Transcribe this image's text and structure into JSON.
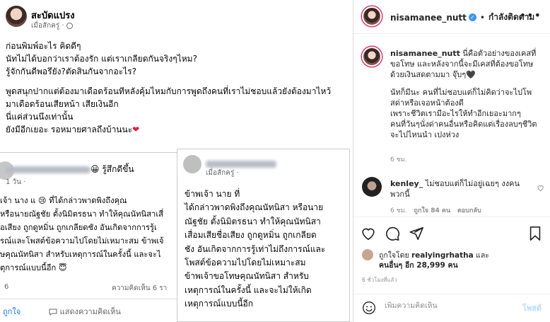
{
  "post_image": {
    "author": "สะบัดแปรง",
    "time": "เมื่อสักครู่ ·",
    "text_lines": [
      "ก่อนพิมพ์อะไร คิดดีๆ",
      "นัทไม่ได้บอกว่าเราต้องรัก แต่เราเกลียดกันจริงๆไหม?",
      "รู้จักกันดีพอรึยัง?ตัดสินกันจากอะไร?",
      "",
      "พูดสนุกปากแต่ต้องมาเดือดร้อนทีหลังคุ้มไหมกับการพูดถึงคนที่เราไม่ชอบแล้วยังต้องมาไหว้",
      "มาเดือดร้อนเสียหน้า เสียเงินอีก",
      "นี่แค่ส่วนนึงเท่านั้น",
      "ยังมีอีกเยอะ รอหมายศาลถึงบ้านนะ"
    ],
    "heart": "❤",
    "shot1": {
      "name_suffix": "😀 รู้สึกดีขึ้น",
      "meta": "1 วัน ·",
      "lines": [
        "เจ้า นาง        แ        😢 ที่ได้กล่าวพาดพิงถึงคุณ",
        "หรือนายณัฐชัย ตั้งนิมิตรธนา ทำให้คุณนัทนิสาเสี่",
        "อเสียง ถูกดูหมิ่น ถูกเกลียดชัง อันเกิดจากการรู้เ",
        "รณ์และโพสต์ข้อความไปโดยไม่เหมาะสม ข้าพเจ้",
        "ษคุณนัทนิสา สำหรับเหตุการณ์ในครั้งนี้ และจะไ",
        "ตุการณ์แบบนี้อีก 😇"
      ],
      "count": "6",
      "comments": "ความคิดเห็น 6 รา",
      "like_label": "ถูกใจ",
      "comment_label": "แสดงความคิดเห็น"
    },
    "shot2": {
      "meta": "เมื่อสักครู่ ·",
      "lines": [
        "ข้าพเจ้า นาย                                  ที่",
        "ได้กล่าวพาดพิงถึงคุณนัทนิสา หรือนาย",
        "ณัฐชัย ตั้งนิมิตรธนา ทำให้คุณนัทนิสา",
        "เสื่อมเสียชื่อเสียง ถูกดูหมิ่น ถูกเกลียด",
        "ชัง อันเกิดจากการรู้เท่าไม่ถึงการณ์และ",
        "โพสต์ข้อความไปโดยไม่เหมาะสม",
        "ข้าพเจ้าขอโทษคุณนัทนิสา สำหรับ",
        "เหตุการณ์ในครั้งนี้ และจะไม่ให้เกิด",
        "เหตุการณ์แบบนี้อีก"
      ]
    }
  },
  "header": {
    "username": "nisamanee_nutt",
    "separator": "•",
    "follow_status": "กำลังติดตาม",
    "more": "•••"
  },
  "caption": {
    "username": "nisamanee_nutt",
    "lines": [
      "นี่คือตัวอย่างของเคสที่",
      "ขอโทษ และหลังจากนี้จะมีเคสที่ต้องขอโทษ",
      "ด้วยเงินสดตามมา จุ๊บๆ🖤",
      "",
      "นัทก็มีนะ คนที่ไม่ชอบแต่ก็ไม่คิดว่าจะไปโพ",
      "สด่าหรือเจอหน้าต้องดี",
      "เพราะชีวิตเรามีอะไรให้ทำอีกเยอะมากๆ",
      "คนที่วันๆนั่งด่าคนอื่นหรือคิดแต่เรื่องลบๆชีวิต",
      "จะไปไหนนำ เปงห่วง"
    ],
    "time": "6 ชม."
  },
  "comment": {
    "username": "kenley_",
    "lines": [
      "ไม่ชอบแต่ก็ไม่อยู่เฉยๆ งงคน",
      "พวกนี้"
    ],
    "time": "6 ชม.",
    "likes": "ถูกใจ 84 คน",
    "reply": "ตอบกลับ"
  },
  "liked_by": {
    "prefix": "ถูกใจโดย",
    "user": "realyingrhatha",
    "and": "และ",
    "others": "คนอื่นๆ อีก 28,999 คน"
  },
  "post_time": "6 ชั่วโมงที่แล้ว",
  "add_comment": {
    "placeholder": "เพิ่มความคิดเห็น",
    "post_label": "โพสต์"
  }
}
